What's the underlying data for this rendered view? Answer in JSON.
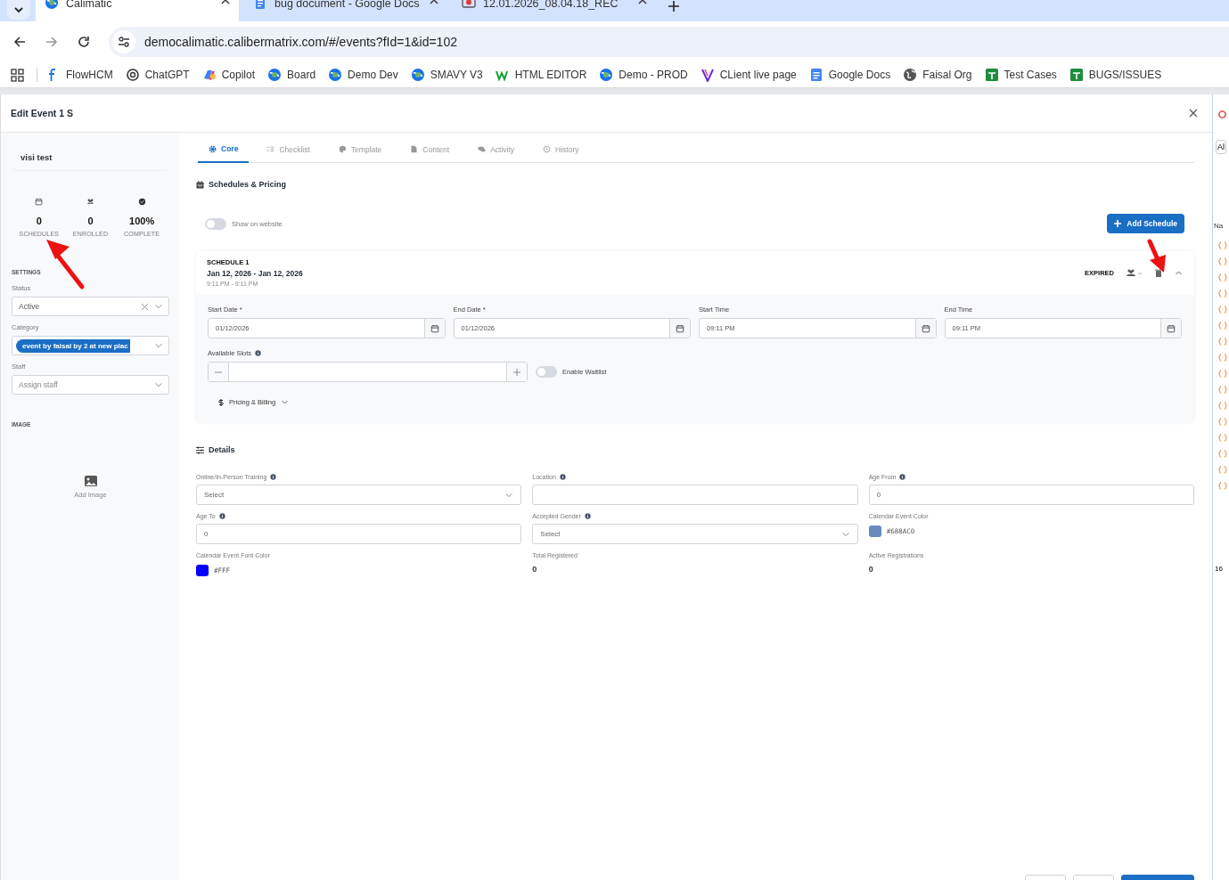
{
  "browser": {
    "tabs": [
      {
        "title": "Calimatic",
        "selected": true
      },
      {
        "title": "bug document - Google Docs",
        "selected": false
      },
      {
        "title": "12.01.2026_08.04.18_REC",
        "selected": false
      }
    ],
    "url": "democalimatic.calibermatrix.com/#/events?fId=1&id=102",
    "bookmarks": [
      {
        "label": "FlowHCM"
      },
      {
        "label": "ChatGPT"
      },
      {
        "label": "Copilot"
      },
      {
        "label": "Board"
      },
      {
        "label": "Demo Dev"
      },
      {
        "label": "SMAVY V3"
      },
      {
        "label": "HTML EDITOR"
      },
      {
        "label": "Demo - PROD"
      },
      {
        "label": "CLient live page"
      },
      {
        "label": "Google Docs"
      },
      {
        "label": "Faisal Org"
      },
      {
        "label": "Test Cases"
      },
      {
        "label": "BUGS/ISSUES"
      }
    ]
  },
  "modal": {
    "title": "Edit Event 1 S",
    "sidebar": {
      "name": "visi test",
      "stats": [
        {
          "value": "0",
          "label": "SCHEDULES"
        },
        {
          "value": "0",
          "label": "ENROLLED"
        },
        {
          "value": "100%",
          "label": "COMPLETE"
        }
      ],
      "settings_heading": "SETTINGS",
      "fields": [
        {
          "label": "Status",
          "kind": "select",
          "value": "Active",
          "clearable": true
        },
        {
          "label": "Category",
          "kind": "chip",
          "value": "event by faisal by 2 at new plac"
        },
        {
          "label": "Staff",
          "kind": "select",
          "placeholder": "Assign staff",
          "clearable": false
        }
      ],
      "image_heading": "IMAGE",
      "add_image": "Add Image"
    },
    "tabs": [
      {
        "label": "Core",
        "selected": true
      },
      {
        "label": "Checklist",
        "selected": false
      },
      {
        "label": "Template",
        "selected": false
      },
      {
        "label": "Content",
        "selected": false
      },
      {
        "label": "Activity",
        "selected": false
      },
      {
        "label": "History",
        "selected": false
      }
    ],
    "schedules": {
      "heading": "Schedules & Pricing",
      "show_on_website": {
        "label": "Show on website",
        "on": false
      },
      "add_button": "Add Schedule",
      "cards": [
        {
          "title": "SCHEDULE 1",
          "dates": "Jan 12, 2026 - Jan 12, 2026",
          "times": "9:11 PM - 9:11 PM",
          "status": "EXPIRED",
          "expanded": true,
          "fields": [
            {
              "label": "Start Date *",
              "value": "01/12/2026"
            },
            {
              "label": "End Date *",
              "value": "01/12/2026"
            },
            {
              "label": "Start Time",
              "value": "09:11 PM"
            },
            {
              "label": "End Time",
              "value": "09:11 PM"
            }
          ],
          "slots_label": "Available Slots",
          "waitlist": {
            "label": "Enable Waitlist",
            "on": false
          },
          "pricing": {
            "label": "Pricing & Billing",
            "expanded": false
          }
        }
      ]
    },
    "details": {
      "heading": "Details",
      "fields": [
        {
          "kind": "select",
          "label": "Online/In-Person Training",
          "info": true,
          "placeholder": "Select"
        },
        {
          "kind": "input",
          "label": "Location",
          "info": true
        },
        {
          "kind": "input",
          "label": "Age From",
          "info": true,
          "value": "0"
        },
        {
          "kind": "input",
          "label": "Age To",
          "info": true,
          "value": "0"
        },
        {
          "kind": "select",
          "label": "Accepted Gender",
          "info": true,
          "placeholder": "Select"
        },
        {
          "kind": "color",
          "label": "Calendar Event Color",
          "info": false,
          "value": "#688AC0",
          "color": "#688ac0"
        },
        {
          "kind": "color",
          "label": "Calendar Event Font Color",
          "info": false,
          "value": "#FFF",
          "color": "#0000ff"
        },
        {
          "kind": "stat",
          "label": "Total Registered",
          "info": false,
          "value": "0"
        },
        {
          "kind": "stat",
          "label": "Active Registrations",
          "info": false,
          "value": "0"
        }
      ]
    }
  },
  "devtools": {
    "filter": "Al",
    "column": "Na",
    "count": "16"
  }
}
